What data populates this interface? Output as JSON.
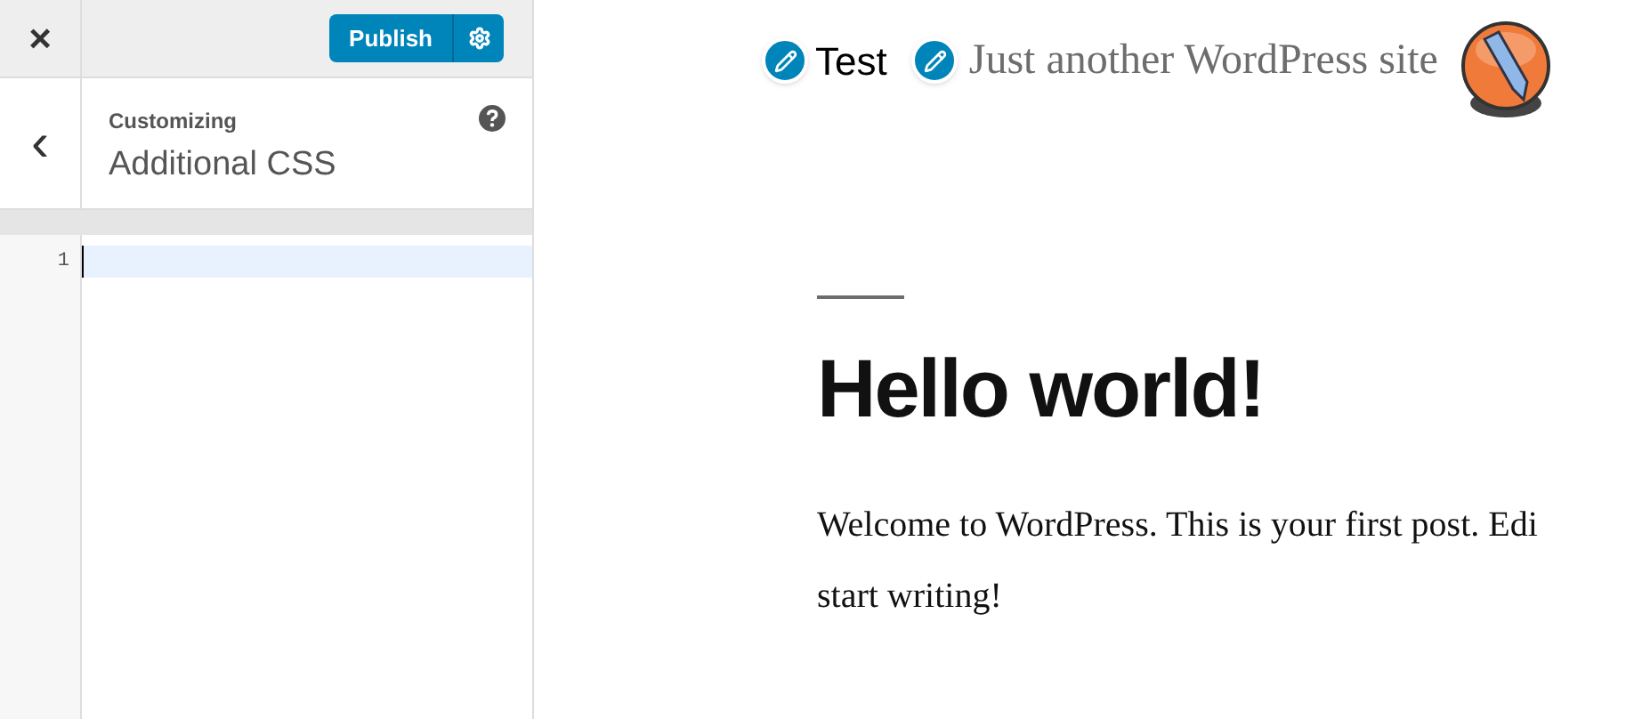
{
  "sidebar": {
    "close": "×",
    "publish": "Publish",
    "header": {
      "back": "‹",
      "subtitle": "Customizing",
      "title": "Additional CSS"
    },
    "editor": {
      "lines": [
        {
          "number": "1",
          "active": true
        }
      ]
    }
  },
  "preview": {
    "site_title": "Test",
    "tagline": "Just another WordPress site",
    "post": {
      "title": "Hello world!",
      "body_lines": [
        "Welcome to WordPress. This is your first post. Edi",
        "start writing!"
      ]
    }
  }
}
